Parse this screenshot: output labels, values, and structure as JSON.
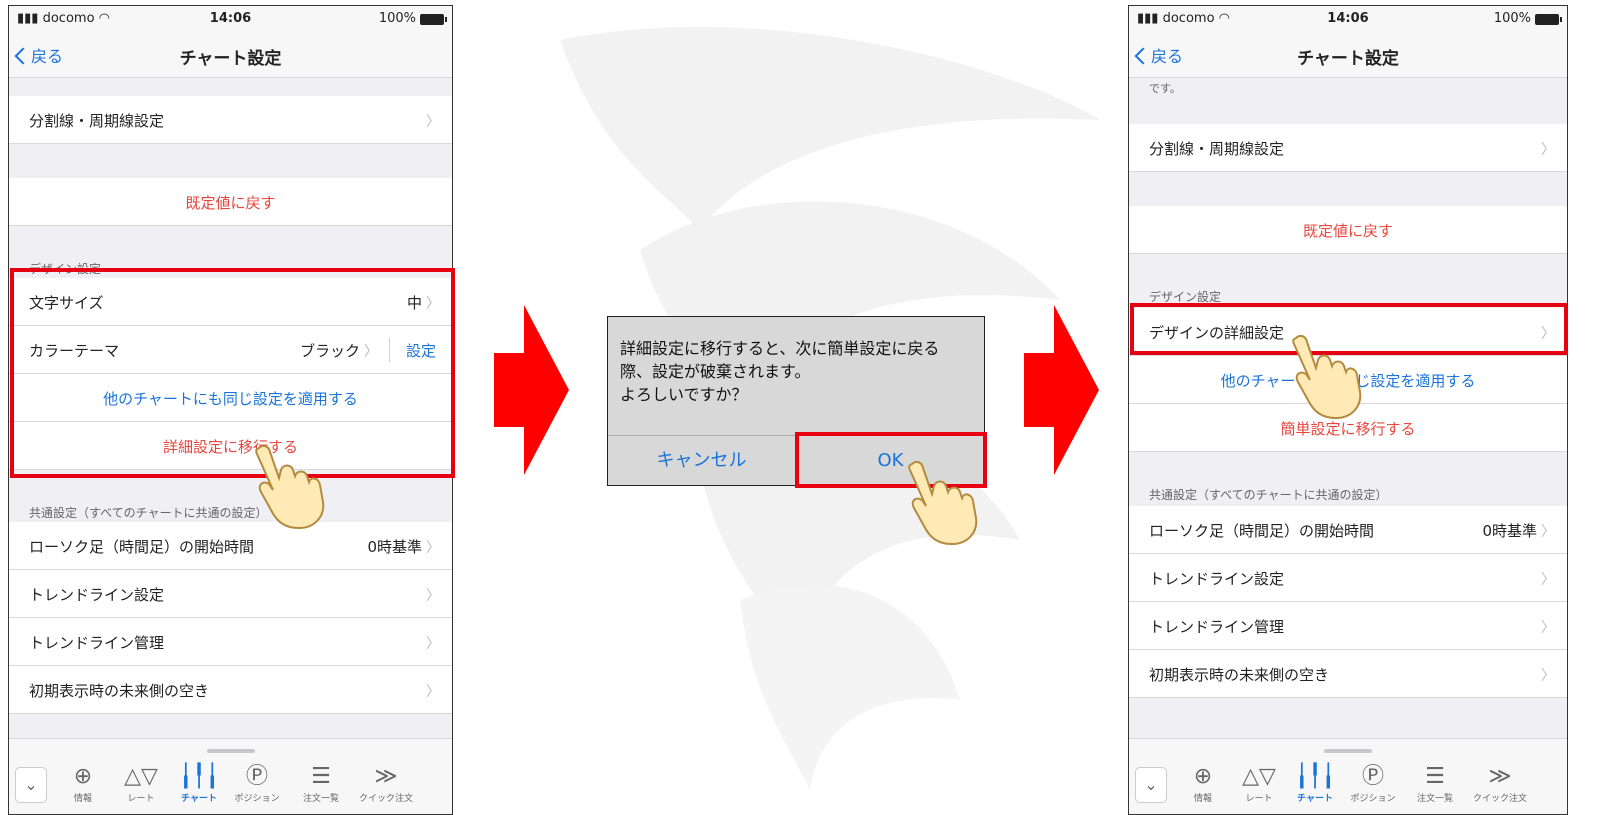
{
  "status": {
    "carrier": "docomo",
    "time": "14:06",
    "battery": "100%"
  },
  "nav": {
    "back": "戻る",
    "title": "チャート設定"
  },
  "left": {
    "rows": {
      "divider": "分割線・周期線設定",
      "reset": "既定値に戻す",
      "font_size": "文字サイズ",
      "font_size_value": "中",
      "color_theme": "カラーテーマ",
      "color_theme_value": "ブラック",
      "color_theme_action": "設定",
      "apply_all": "他のチャートにも同じ設定を適用する",
      "to_detail": "詳細設定に移行する",
      "candle_start": "ローソク足（時間足）の開始時間",
      "candle_start_value": "0時基準",
      "trend_setting": "トレンドライン設定",
      "trend_manage": "トレンドライン管理",
      "future_space": "初期表示時の未来側の空き"
    },
    "design_header": "デザイン設定",
    "common_header": "共通設定（すべてのチャートに共通の設定）"
  },
  "right": {
    "partial_text": "です。",
    "rows": {
      "divider": "分割線・周期線設定",
      "reset": "既定値に戻す",
      "design_detail": "デザインの詳細設定",
      "apply_all": "他のチャートにも同じ設定を適用する",
      "to_simple": "簡単設定に移行する",
      "candle_start": "ローソク足（時間足）の開始時間",
      "candle_start_value": "0時基準",
      "trend_setting": "トレンドライン設定",
      "trend_manage": "トレンドライン管理",
      "future_space": "初期表示時の未来側の空き"
    },
    "design_header": "デザイン設定",
    "common_header": "共通設定（すべてのチャートに共通の設定）"
  },
  "dialog": {
    "message_line1": "詳細設定に移行すると、次に簡単設定に戻る",
    "message_line2": "際、設定が破棄されます。",
    "message_line3": "よろしいですか？",
    "cancel": "キャンセル",
    "ok": "OK"
  },
  "tabs": [
    {
      "label": "情報",
      "icon": "globe-icon"
    },
    {
      "label": "レート",
      "icon": "rate-triangles-icon"
    },
    {
      "label": "チャート",
      "icon": "candlestick-chart-icon"
    },
    {
      "label": "ポジション",
      "icon": "position-p-icon"
    },
    {
      "label": "注文一覧",
      "icon": "order-list-icon"
    },
    {
      "label": "クイック注文",
      "icon": "double-chevron-right-icon"
    }
  ],
  "colors": {
    "accent_blue": "#1a73d9",
    "alert_red": "#e8453c",
    "highlight_red": "#e60012"
  }
}
